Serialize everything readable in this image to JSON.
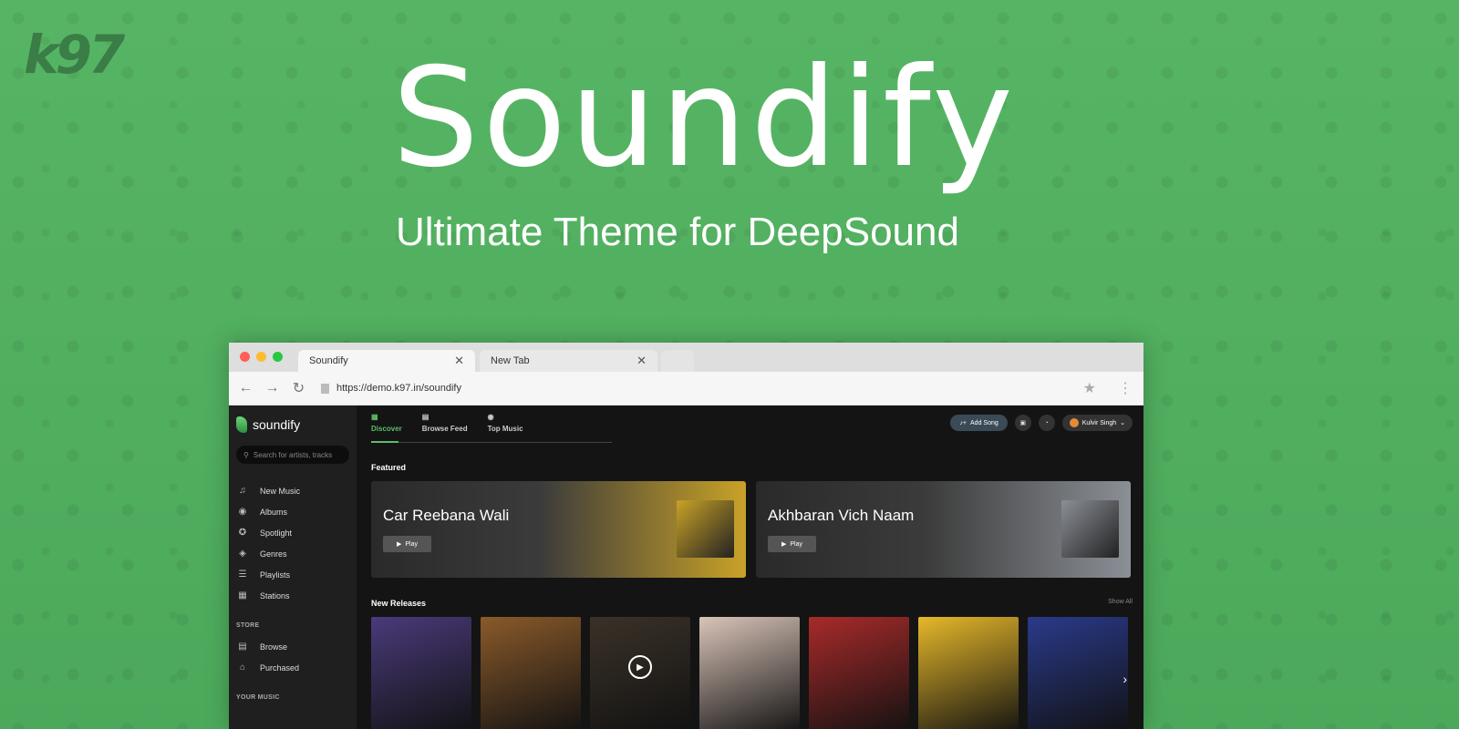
{
  "hero": {
    "logo": "k97",
    "title": "Soundify",
    "subtitle": "Ultimate Theme for DeepSound"
  },
  "browser": {
    "tabs": [
      {
        "label": "Soundify",
        "active": true
      },
      {
        "label": "New Tab",
        "active": false
      }
    ],
    "close_glyph": "✕",
    "url": "https://demo.k97.in/soundify"
  },
  "app": {
    "brand": "soundify",
    "search_placeholder": "Search for artists, tracks",
    "menu": [
      {
        "label": "New Music",
        "icon": "♫"
      },
      {
        "label": "Albums",
        "icon": "◉"
      },
      {
        "label": "Spotlight",
        "icon": "✪"
      },
      {
        "label": "Genres",
        "icon": "◈"
      },
      {
        "label": "Playlists",
        "icon": "☰"
      },
      {
        "label": "Stations",
        "icon": "▦"
      }
    ],
    "store_label": "STORE",
    "store_menu": [
      {
        "label": "Browse",
        "icon": "▤"
      },
      {
        "label": "Purchased",
        "icon": "⌂"
      }
    ],
    "your_music_label": "YOUR MUSIC",
    "topnav": [
      {
        "label": "Discover",
        "icon": "▦",
        "active": true
      },
      {
        "label": "Browse Feed",
        "icon": "▤",
        "active": false
      },
      {
        "label": "Top Music",
        "icon": "◉",
        "active": false
      }
    ],
    "add_song": "Add Song",
    "user_name": "Kulvir Singh",
    "featured_label": "Featured",
    "featured": [
      {
        "title": "Car Reebana Wali",
        "play": "Play",
        "color": "#c9a227"
      },
      {
        "title": "Akhbaran Vich Naam",
        "play": "Play",
        "color": "#8b8f96"
      }
    ],
    "new_releases_label": "New Releases",
    "show_all": "Show All",
    "release_colors": [
      "#4a3a7a",
      "#8a5a2a",
      "#3a3228",
      "#d9c4b8",
      "#a82a2a",
      "#e6b82a",
      "#2a3a8a"
    ]
  },
  "colors": {
    "accent": "#5bbd6a",
    "background": "#4fae5e"
  }
}
